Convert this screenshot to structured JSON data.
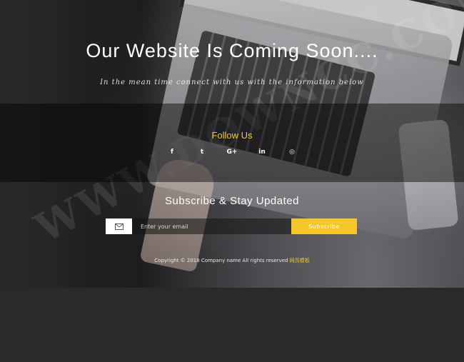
{
  "hero": {
    "title": "Our Website Is Coming Soon....",
    "tagline": "In the mean time connect with us with the information below"
  },
  "follow": {
    "title": "Follow Us",
    "social": [
      {
        "label": "f",
        "icon": "facebook-icon"
      },
      {
        "label": "t",
        "icon": "twitter-icon"
      },
      {
        "label": "G+",
        "icon": "google-plus-icon"
      },
      {
        "label": "in",
        "icon": "linkedin-icon"
      },
      {
        "label": "◎",
        "icon": "instagram-icon"
      }
    ]
  },
  "subscribe": {
    "title": "Subscribe & Stay Updated",
    "placeholder": "Enter your email",
    "button_label": "Subscribe",
    "mail_icon": "✉"
  },
  "footer": {
    "copyright_text": "Copyright © 2018 Company name All rights reserved",
    "link_text": "网页模板"
  },
  "watermark": {
    "text": "WWW.DOWNCC.COM"
  },
  "colors": {
    "accent": "#f3c62a",
    "text": "#ffffff"
  }
}
